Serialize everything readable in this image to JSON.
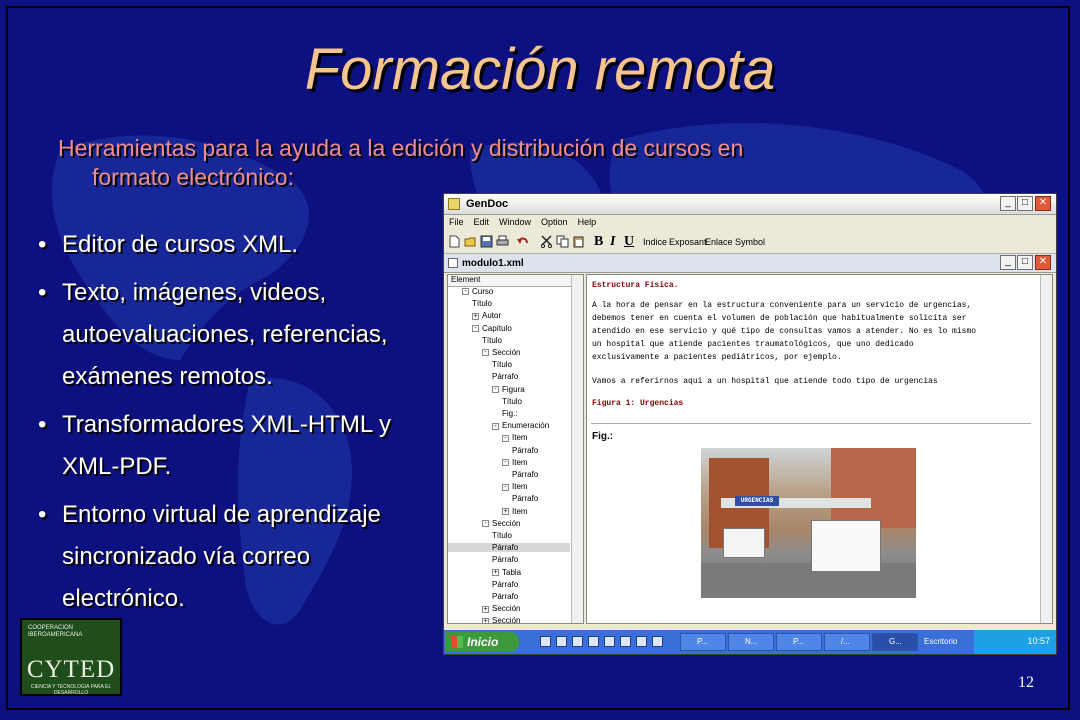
{
  "slide": {
    "title": "Formación remota",
    "subtitle_line1": "Herramientas para la ayuda a la edición y distribución de cursos en",
    "subtitle_line2": "formato electrónico:",
    "bullets": [
      "Editor de cursos XML.",
      "Texto, imágenes, videos, autoevaluaciones, referencias, exámenes remotos.",
      "Transformadores XML-HTML y XML-PDF.",
      "Entorno virtual de aprendizaje sincronizado vía correo electrónico."
    ],
    "page_number": "12",
    "logo": {
      "top_text": "COOPERACION IBEROAMERICANA",
      "name": "CYTED",
      "tagline": "CIENCIA Y TECNOLOGIA PARA EL DESARROLLO"
    },
    "colors": {
      "background": "#0d1180",
      "title": "#f6c48e",
      "subtitle": "#f08c8c"
    }
  },
  "app": {
    "window_title": "GenDoc",
    "menu": [
      "File",
      "Edit",
      "Window",
      "Option",
      "Help"
    ],
    "toolbar_text": [
      "Indice",
      "Exposant",
      "Enlace",
      "Symbol"
    ],
    "document_title": "modulo1.xml",
    "tree_header": "Element",
    "tree": [
      {
        "label": "Curso",
        "toggle": "-"
      },
      {
        "label": "Título",
        "toggle": ""
      },
      {
        "label": "Autor",
        "toggle": "+"
      },
      {
        "label": "Capítulo",
        "toggle": "-"
      },
      {
        "label": "Título",
        "toggle": ""
      },
      {
        "label": "Sección",
        "toggle": "-"
      },
      {
        "label": "Título",
        "toggle": ""
      },
      {
        "label": "Párrafo",
        "toggle": ""
      },
      {
        "label": "Figura",
        "toggle": "-"
      },
      {
        "label": "Título",
        "toggle": ""
      },
      {
        "label": "Fig.:",
        "toggle": ""
      },
      {
        "label": "Enumeración",
        "toggle": "-"
      },
      {
        "label": "Item",
        "toggle": "-"
      },
      {
        "label": "Párrafo",
        "toggle": ""
      },
      {
        "label": "Item",
        "toggle": "-"
      },
      {
        "label": "Párrafo",
        "toggle": ""
      },
      {
        "label": "Item",
        "toggle": "-"
      },
      {
        "label": "Párrafo",
        "toggle": ""
      },
      {
        "label": "Item",
        "toggle": "+"
      },
      {
        "label": "Sección",
        "toggle": "-"
      },
      {
        "label": "Título",
        "toggle": ""
      },
      {
        "label": "Párrafo",
        "toggle": ""
      },
      {
        "label": "Párrafo",
        "toggle": ""
      },
      {
        "label": "Tabla",
        "toggle": "+"
      },
      {
        "label": "Párrafo",
        "toggle": ""
      },
      {
        "label": "Párrafo",
        "toggle": ""
      },
      {
        "label": "Sección",
        "toggle": "+"
      },
      {
        "label": "Sección",
        "toggle": "+"
      }
    ],
    "selected_tree_index": 21,
    "content": {
      "heading": "Estructura Física.",
      "paragraph": [
        "A la hora de pensar en la estructura conveniente para un servicio de urgencias,",
        "debemos tener en cuenta el volumen de población que habitualmente solicita ser",
        "atendido en ese servicio y qué tipo de consultas vamos a atender. No es lo mismo",
        "un hospital que atiende pacientes traumatológicos, que uno dedicado",
        "exclusivamente a pacientes pediátricos, por ejemplo."
      ],
      "paragraph2": "Vamos a referirnos aquí a un hospital que atiende todo tipo de urgencias",
      "figure_title": "Figura 1: Urgencias",
      "figure_label": "Fig.:",
      "photo_sign": "URGENCIAS"
    },
    "taskbar": {
      "start": "Inicio",
      "buttons": [
        "P...",
        "N...",
        "P...",
        "/...",
        "G..."
      ],
      "desktop": "Escritorio",
      "clock": "10:57"
    }
  }
}
